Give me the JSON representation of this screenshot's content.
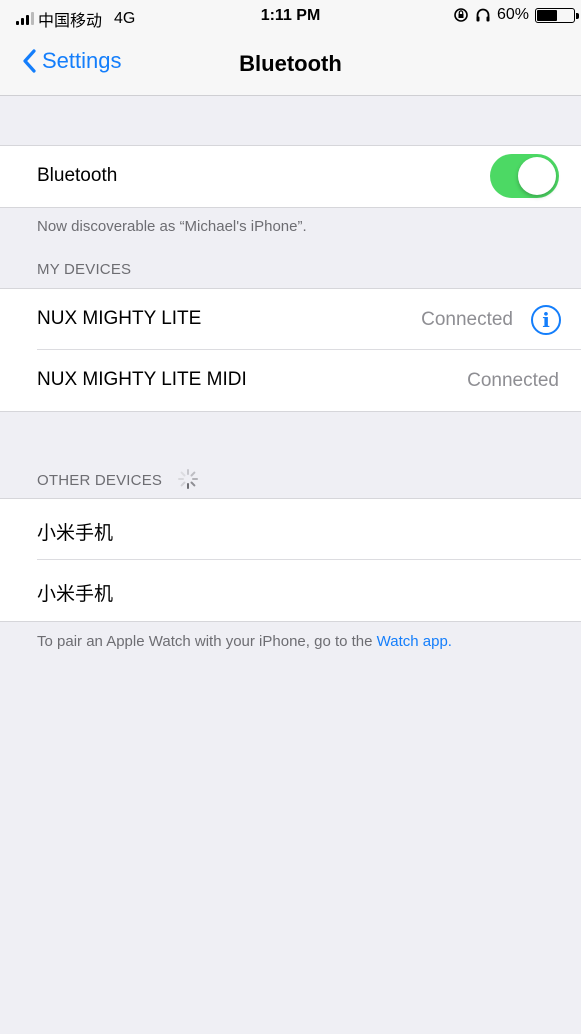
{
  "status_bar": {
    "carrier": "中国移动",
    "network": "4G",
    "time": "1:11 PM",
    "battery_percent": "60%",
    "battery_level": 0.6
  },
  "nav": {
    "back_label": "Settings",
    "title": "Bluetooth"
  },
  "bluetooth": {
    "label": "Bluetooth",
    "enabled": true,
    "toggle_color": "#4cd964",
    "discoverable_note": "Now discoverable as “Michael's iPhone”."
  },
  "my_devices": {
    "header": "MY DEVICES",
    "items": [
      {
        "name": "NUX MIGHTY LITE",
        "status": "Connected"
      },
      {
        "name": "NUX MIGHTY LITE MIDI",
        "status": "Connected"
      }
    ]
  },
  "other_devices": {
    "header": "OTHER DEVICES",
    "items": [
      {
        "name": "小米手机"
      },
      {
        "name": "小米手机"
      }
    ]
  },
  "footer": {
    "text": "To pair an Apple Watch with your iPhone, go to the ",
    "link": "Watch app."
  },
  "colors": {
    "accent": "#147efb",
    "background": "#efeff4",
    "secondary_text": "#6d6d72"
  }
}
